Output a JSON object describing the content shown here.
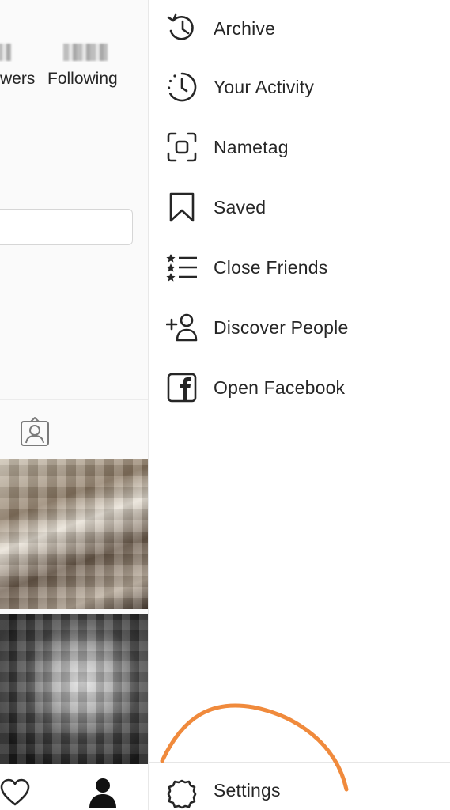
{
  "profile": {
    "followers_label": "wers",
    "following_label": "Following"
  },
  "drawer": {
    "items": [
      {
        "label": "Archive",
        "icon": "archive-icon"
      },
      {
        "label": "Your Activity",
        "icon": "activity-icon"
      },
      {
        "label": "Nametag",
        "icon": "nametag-icon"
      },
      {
        "label": "Saved",
        "icon": "bookmark-icon"
      },
      {
        "label": "Close Friends",
        "icon": "close-friends-icon"
      },
      {
        "label": "Discover People",
        "icon": "add-person-icon"
      },
      {
        "label": "Open Facebook",
        "icon": "facebook-icon"
      }
    ],
    "settings": {
      "label": "Settings",
      "icon": "gear-icon"
    }
  },
  "colors": {
    "text": "#262626",
    "annotation_stroke": "#f08a3c",
    "divider": "#e6e6e6"
  }
}
